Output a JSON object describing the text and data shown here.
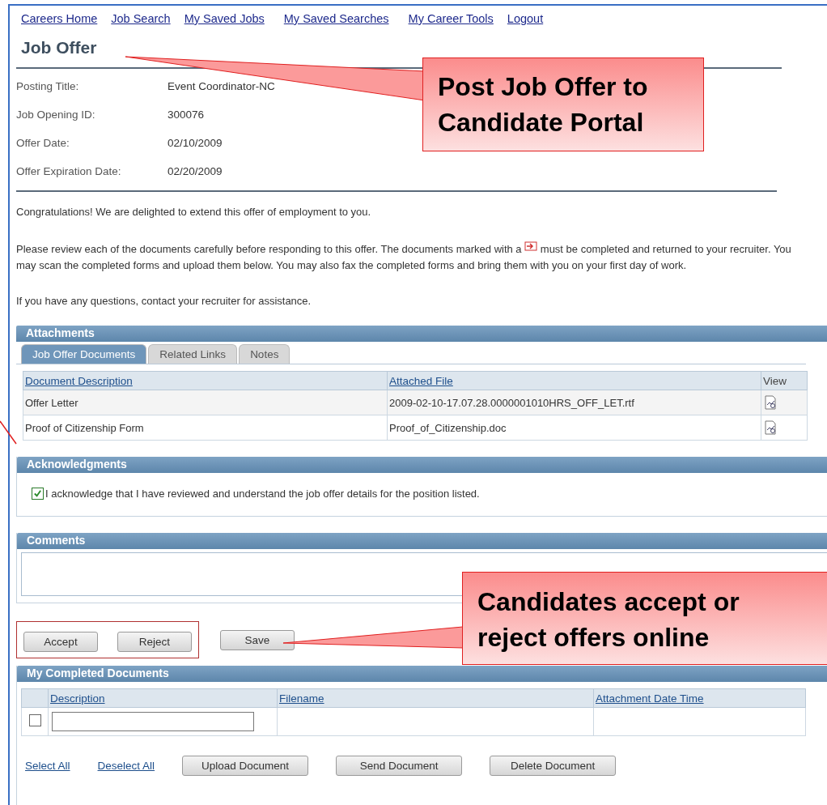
{
  "nav": [
    "Careers Home",
    "Job Search",
    "My Saved Jobs",
    "My Saved Searches",
    "My Career Tools",
    "Logout"
  ],
  "title": "Job Offer",
  "fields": [
    {
      "label": "Posting Title:",
      "value": "Event Coordinator-NC"
    },
    {
      "label": "Job Opening ID:",
      "value": "300076"
    },
    {
      "label": "Offer Date:",
      "value": "02/10/2009"
    },
    {
      "label": "Offer Expiration Date:",
      "value": "02/20/2009"
    }
  ],
  "intro": "Congratulations! We are delighted to extend this offer of employment to you.",
  "instructions": {
    "before": "Please review each of the documents carefully before responding to this offer. The documents marked with a",
    "after": "must be completed and returned to your recruiter. You may scan the completed forms and upload them below. You may also fax the completed forms and bring them with you on your first day of work."
  },
  "contact": "If you have any questions, contact your recruiter for assistance.",
  "attachments": {
    "title": "Attachments",
    "tabs": [
      {
        "label": "Job Offer Documents",
        "selected": true
      },
      {
        "label": "Related Links",
        "selected": false
      },
      {
        "label": "Notes",
        "selected": false
      }
    ],
    "columns": [
      "Document Description",
      "Attached File",
      "View"
    ],
    "rows": [
      {
        "description": "Offer Letter",
        "file": "2009-02-10-17.07.28.0000001010HRS_OFF_LET.rtf"
      },
      {
        "description": "Proof of Citizenship Form",
        "file": "Proof_of_Citizenship.doc"
      }
    ]
  },
  "acknowledgments": {
    "title": "Acknowledgments",
    "items": [
      {
        "text": "I acknowledge that I have reviewed and understand the job offer details for the position listed.",
        "checked": true
      }
    ]
  },
  "comments": {
    "title": "Comments"
  },
  "actions": [
    {
      "label": "Accept",
      "framed": true
    },
    {
      "label": "Reject",
      "framed": true
    },
    {
      "label": "Save",
      "framed": false
    }
  ],
  "completed": {
    "title": "My Completed Documents",
    "columns": [
      "Description",
      "Filename",
      "Attachment Date Time"
    ],
    "rows": [
      {
        "checked": false
      }
    ],
    "links": [
      "Select All",
      "Deselect All"
    ],
    "buttons": [
      "Upload Document",
      "Send Document",
      "Delete Document"
    ]
  },
  "callouts": [
    {
      "text": "Post Job Offer to Candidate Portal"
    },
    {
      "text": "Candidates accept or reject offers online"
    }
  ]
}
